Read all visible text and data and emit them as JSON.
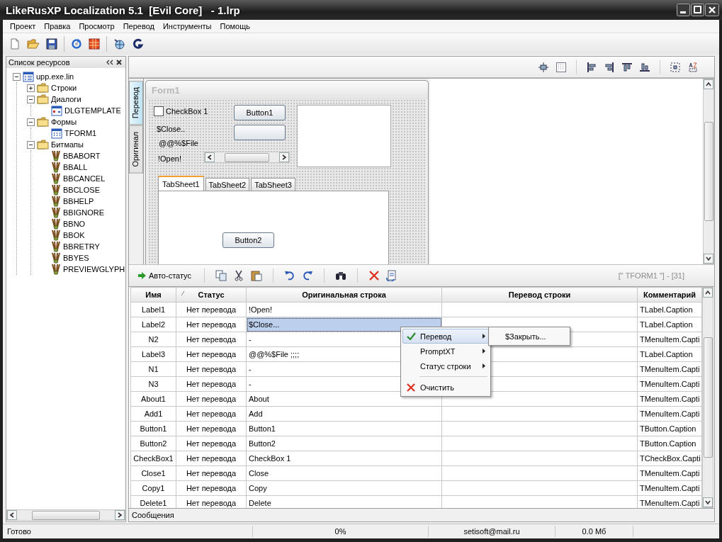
{
  "window": {
    "title": "LikeRusXP Localization 5.1  [Evil Core]   - 1.lrp"
  },
  "menu": [
    "Проект",
    "Правка",
    "Просмотр",
    "Перевод",
    "Инструменты",
    "Помощь"
  ],
  "resources": {
    "title": "Список ресурсов",
    "tree": [
      {
        "label": "upp.exe.lin",
        "kind": "file",
        "expanded": true,
        "children": [
          {
            "label": "Строки",
            "kind": "folder",
            "expanded": false
          },
          {
            "label": "Диалоги",
            "kind": "folder",
            "expanded": true,
            "children": [
              {
                "label": "DLGTEMPLATE",
                "kind": "dialog"
              }
            ]
          },
          {
            "label": "Формы",
            "kind": "folder",
            "expanded": true,
            "children": [
              {
                "label": "TFORM1",
                "kind": "form"
              }
            ]
          },
          {
            "label": "Битмапы",
            "kind": "folder",
            "expanded": true,
            "children": [
              {
                "label": "BBABORT",
                "kind": "bitmap"
              },
              {
                "label": "BBALL",
                "kind": "bitmap"
              },
              {
                "label": "BBCANCEL",
                "kind": "bitmap"
              },
              {
                "label": "BBCLOSE",
                "kind": "bitmap"
              },
              {
                "label": "BBHELP",
                "kind": "bitmap"
              },
              {
                "label": "BBIGNORE",
                "kind": "bitmap"
              },
              {
                "label": "BBNO",
                "kind": "bitmap"
              },
              {
                "label": "BBOK",
                "kind": "bitmap"
              },
              {
                "label": "BBRETRY",
                "kind": "bitmap"
              },
              {
                "label": "BBYES",
                "kind": "bitmap"
              },
              {
                "label": "PREVIEWGLYPH",
                "kind": "bitmap"
              }
            ]
          }
        ]
      }
    ]
  },
  "designer": {
    "side_tabs": [
      {
        "label": "Перевод",
        "selected": true
      },
      {
        "label": "Оригинал",
        "selected": false
      }
    ],
    "form": {
      "title": "Form1",
      "controls": [
        {
          "kind": "checkbox",
          "label": "CheckBox 1",
          "checked": false
        },
        {
          "kind": "button",
          "label": "Button1"
        },
        {
          "kind": "button"
        },
        {
          "kind": "label",
          "label": "$Close.."
        },
        {
          "kind": "label",
          "label": "@@%$File"
        },
        {
          "kind": "label",
          "label": "!Open!"
        },
        {
          "kind": "scrollbar"
        },
        {
          "kind": "memo"
        },
        {
          "kind": "pagecontrol",
          "tabs": [
            {
              "label": "TabSheet1",
              "selected": true
            },
            {
              "label": "TabSheet2",
              "selected": false
            },
            {
              "label": "TabSheet3",
              "selected": false
            }
          ]
        },
        {
          "kind": "button",
          "label": "Button2"
        }
      ]
    }
  },
  "grid_toolbar": {
    "auto_status": "Авто-статус",
    "location": "[\" TFORM1 \"] - [31]"
  },
  "table": {
    "columns": [
      {
        "label": "Имя",
        "sorted": false
      },
      {
        "label": "Статус",
        "sorted": true
      },
      {
        "label": "Оригинальная строка",
        "sorted": false
      },
      {
        "label": "Перевод строки",
        "sorted": false
      },
      {
        "label": "Комментарий",
        "sorted": false
      }
    ],
    "rows": [
      {
        "name": "Label1",
        "status": "Нет перевода",
        "original": "!Open!",
        "comment": "TLabel.Caption",
        "selected": false
      },
      {
        "name": "Label2",
        "status": "Нет перевода",
        "original": "$Close...",
        "comment": "TLabel.Caption",
        "selected": true
      },
      {
        "name": "N2",
        "status": "Нет перевода",
        "original": "-",
        "comment": "TMenuItem.Capti",
        "selected": false
      },
      {
        "name": "Label3",
        "status": "Нет перевода",
        "original": "@@%$File ;;;;",
        "comment": "TLabel.Caption",
        "selected": false
      },
      {
        "name": "N1",
        "status": "Нет перевода",
        "original": "-",
        "comment": "TMenuItem.Capti",
        "selected": false
      },
      {
        "name": "N3",
        "status": "Нет перевода",
        "original": "-",
        "comment": "TMenuItem.Capti",
        "selected": false
      },
      {
        "name": "About1",
        "status": "Нет перевода",
        "original": "About",
        "comment": "TMenuItem.Capti",
        "selected": false
      },
      {
        "name": "Add1",
        "status": "Нет перевода",
        "original": "Add",
        "comment": "TMenuItem.Capti",
        "selected": false
      },
      {
        "name": "Button1",
        "status": "Нет перевода",
        "original": "Button1",
        "comment": "TButton.Caption",
        "selected": false
      },
      {
        "name": "Button2",
        "status": "Нет перевода",
        "original": "Button2",
        "comment": "TButton.Caption",
        "selected": false
      },
      {
        "name": "CheckBox1",
        "status": "Нет перевода",
        "original": "CheckBox 1",
        "comment": "TCheckBox.Capti",
        "selected": false
      },
      {
        "name": "Close1",
        "status": "Нет перевода",
        "original": "Close",
        "comment": "TMenuItem.Capti",
        "selected": false
      },
      {
        "name": "Copy1",
        "status": "Нет перевода",
        "original": "Copy",
        "comment": "TMenuItem.Capti",
        "selected": false
      },
      {
        "name": "Delete1",
        "status": "Нет перевода",
        "original": "Delete",
        "comment": "TMenuItem.Capti",
        "selected": false
      }
    ]
  },
  "context_menu": {
    "items": [
      {
        "kind": "submenu",
        "label": "Перевод",
        "checked": true,
        "selected": true
      },
      {
        "kind": "submenu",
        "label": "PromptXT",
        "checked": false,
        "selected": false
      },
      {
        "kind": "submenu",
        "label": "Статус строки",
        "checked": false,
        "selected": false
      },
      {
        "kind": "separator"
      },
      {
        "kind": "action",
        "label": "Очистить",
        "selected": false
      }
    ],
    "submenu": [
      "$Закрыть..."
    ]
  },
  "messages": {
    "title": "Сообщения"
  },
  "status_bar": [
    "Готово",
    "0%",
    "setisoft@mail.ru",
    "0.0 Мб"
  ]
}
